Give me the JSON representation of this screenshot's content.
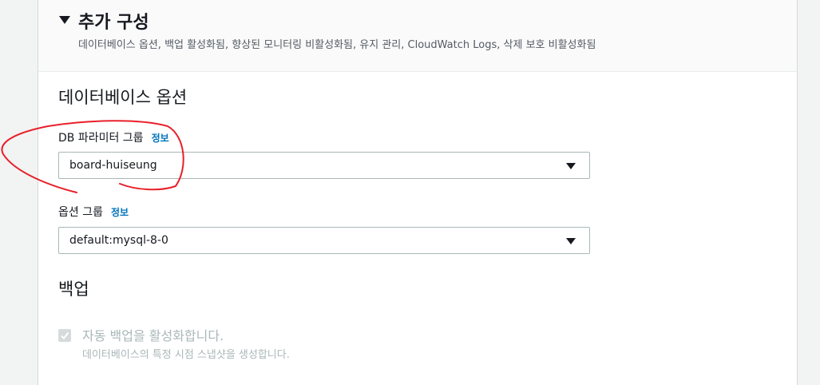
{
  "section": {
    "title": "추가 구성",
    "description": "데이터베이스 옵션, 백업 활성화됨, 향상된 모니터링 비활성화됨, 유지 관리, CloudWatch Logs, 삭제 보호 비활성화됨"
  },
  "database_options": {
    "heading": "데이터베이스 옵션",
    "db_parameter_group": {
      "label": "DB 파라미터 그룹",
      "info": "정보",
      "value": "board-huiseung"
    },
    "option_group": {
      "label": "옵션 그룹",
      "info": "정보",
      "value": "default:mysql-8-0"
    }
  },
  "backup": {
    "heading": "백업",
    "auto_backup": {
      "label": "자동 백업을 활성화합니다.",
      "description": "데이터베이스의 특정 시점 스냅샷을 생성합니다.",
      "checked": true,
      "disabled": true
    }
  },
  "colors": {
    "link": "#0073bb",
    "annotation": "#e8202a",
    "disabled_text": "#aab7b8"
  }
}
